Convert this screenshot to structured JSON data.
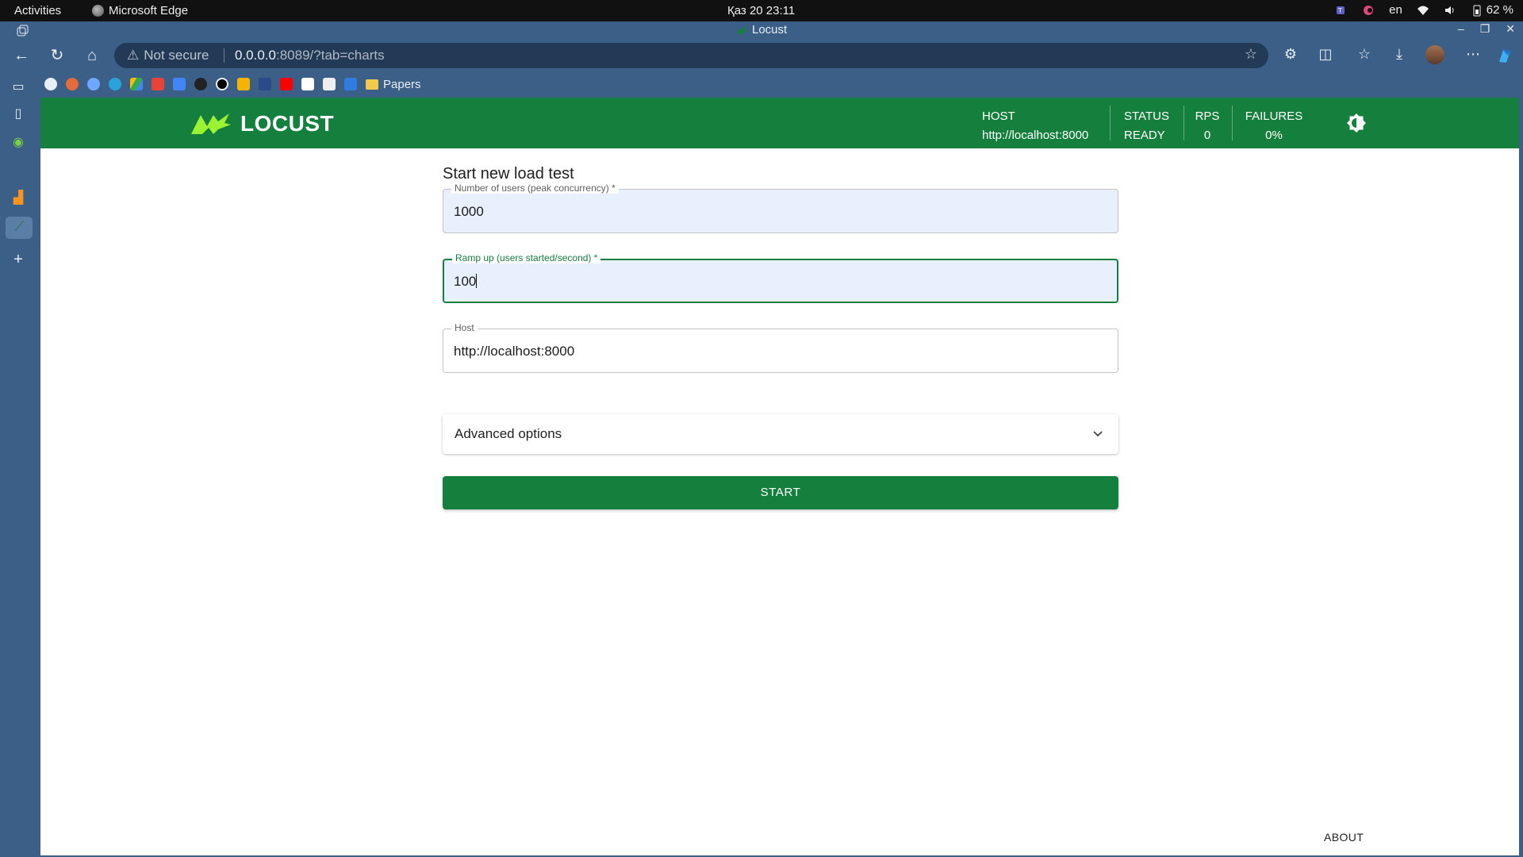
{
  "system_bar": {
    "activities": "Activities",
    "app_name": "Microsoft Edge",
    "clock": "Қаз 20  23:11",
    "language": "en",
    "battery": "62 %"
  },
  "window": {
    "title": "Locust"
  },
  "browser": {
    "security_label": "Not secure",
    "url_host": "0.0.0.0",
    "url_rest": ":8089/?tab=charts",
    "bookmark_folder": "Papers"
  },
  "header": {
    "logo_text": "LOCUST",
    "host_label": "HOST",
    "host_value": "http://localhost:8000",
    "status_label": "STATUS",
    "status_value": "READY",
    "rps_label": "RPS",
    "rps_value": "0",
    "failures_label": "FAILURES",
    "failures_value": "0%"
  },
  "form": {
    "title": "Start new load test",
    "users_label": "Number of users (peak concurrency) *",
    "users_value": "1000",
    "ramp_label": "Ramp up (users started/second) *",
    "ramp_value": "100",
    "host_label": "Host",
    "host_value": "http://localhost:8000",
    "advanced_label": "Advanced options",
    "start_label": "START"
  },
  "footer": {
    "about_label": "ABOUT"
  },
  "colors": {
    "brand_green": "#15803d",
    "logo_lime": "#9bf233",
    "browser_frame": "#3b5f86"
  }
}
